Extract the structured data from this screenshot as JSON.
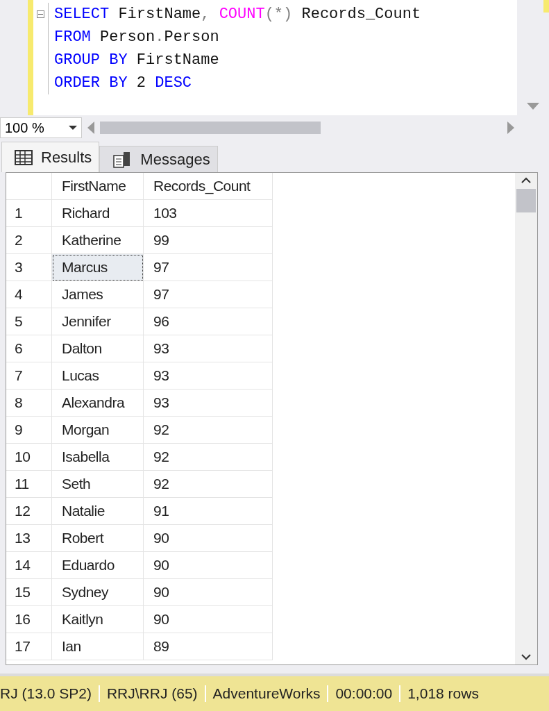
{
  "editor": {
    "lines": [
      {
        "tokens": [
          {
            "text": "SELECT",
            "kind": "keyword"
          },
          {
            "text": " FirstName",
            "kind": "plain"
          },
          {
            "text": ", ",
            "kind": "punct"
          },
          {
            "text": "COUNT",
            "kind": "func"
          },
          {
            "text": "(*)",
            "kind": "punct"
          },
          {
            "text": " Records_Count",
            "kind": "plain"
          }
        ],
        "collapsible": true
      },
      {
        "tokens": [
          {
            "text": "FROM",
            "kind": "keyword"
          },
          {
            "text": " Person",
            "kind": "plain"
          },
          {
            "text": ".",
            "kind": "punct"
          },
          {
            "text": "Person",
            "kind": "plain"
          }
        ],
        "collapsible": false
      },
      {
        "tokens": [
          {
            "text": "GROUP BY",
            "kind": "keyword"
          },
          {
            "text": " FirstName",
            "kind": "plain"
          }
        ],
        "collapsible": false
      },
      {
        "tokens": [
          {
            "text": "ORDER BY",
            "kind": "keyword"
          },
          {
            "text": " 2 ",
            "kind": "plain"
          },
          {
            "text": "DESC",
            "kind": "keyword"
          }
        ],
        "collapsible": false
      }
    ]
  },
  "zoom": {
    "value": "100 %"
  },
  "tabs": [
    {
      "label": "Results",
      "kind": "grid",
      "selected": true
    },
    {
      "label": "Messages",
      "kind": "messages",
      "selected": false
    }
  ],
  "table": {
    "columns": [
      "FirstName",
      "Records_Count"
    ],
    "rows": [
      {
        "num": "1",
        "name": "Richard",
        "count": "103",
        "selected": false
      },
      {
        "num": "2",
        "name": "Katherine",
        "count": "99",
        "selected": false
      },
      {
        "num": "3",
        "name": "Marcus",
        "count": "97",
        "selected": true
      },
      {
        "num": "4",
        "name": "James",
        "count": "97",
        "selected": false
      },
      {
        "num": "5",
        "name": "Jennifer",
        "count": "96",
        "selected": false
      },
      {
        "num": "6",
        "name": "Dalton",
        "count": "93",
        "selected": false
      },
      {
        "num": "7",
        "name": "Lucas",
        "count": "93",
        "selected": false
      },
      {
        "num": "8",
        "name": "Alexandra",
        "count": "93",
        "selected": false
      },
      {
        "num": "9",
        "name": "Morgan",
        "count": "92",
        "selected": false
      },
      {
        "num": "10",
        "name": "Isabella",
        "count": "92",
        "selected": false
      },
      {
        "num": "11",
        "name": "Seth",
        "count": "92",
        "selected": false
      },
      {
        "num": "12",
        "name": "Natalie",
        "count": "91",
        "selected": false
      },
      {
        "num": "13",
        "name": "Robert",
        "count": "90",
        "selected": false
      },
      {
        "num": "14",
        "name": "Eduardo",
        "count": "90",
        "selected": false
      },
      {
        "num": "15",
        "name": "Sydney",
        "count": "90",
        "selected": false
      },
      {
        "num": "16",
        "name": "Kaitlyn",
        "count": "90",
        "selected": false
      },
      {
        "num": "17",
        "name": "Ian",
        "count": "89",
        "selected": false
      }
    ]
  },
  "status_bar": [
    "RJ (13.0 SP2)",
    "RRJ\\RRJ (65)",
    "AdventureWorks",
    "00:00:00",
    "1,018 rows"
  ]
}
